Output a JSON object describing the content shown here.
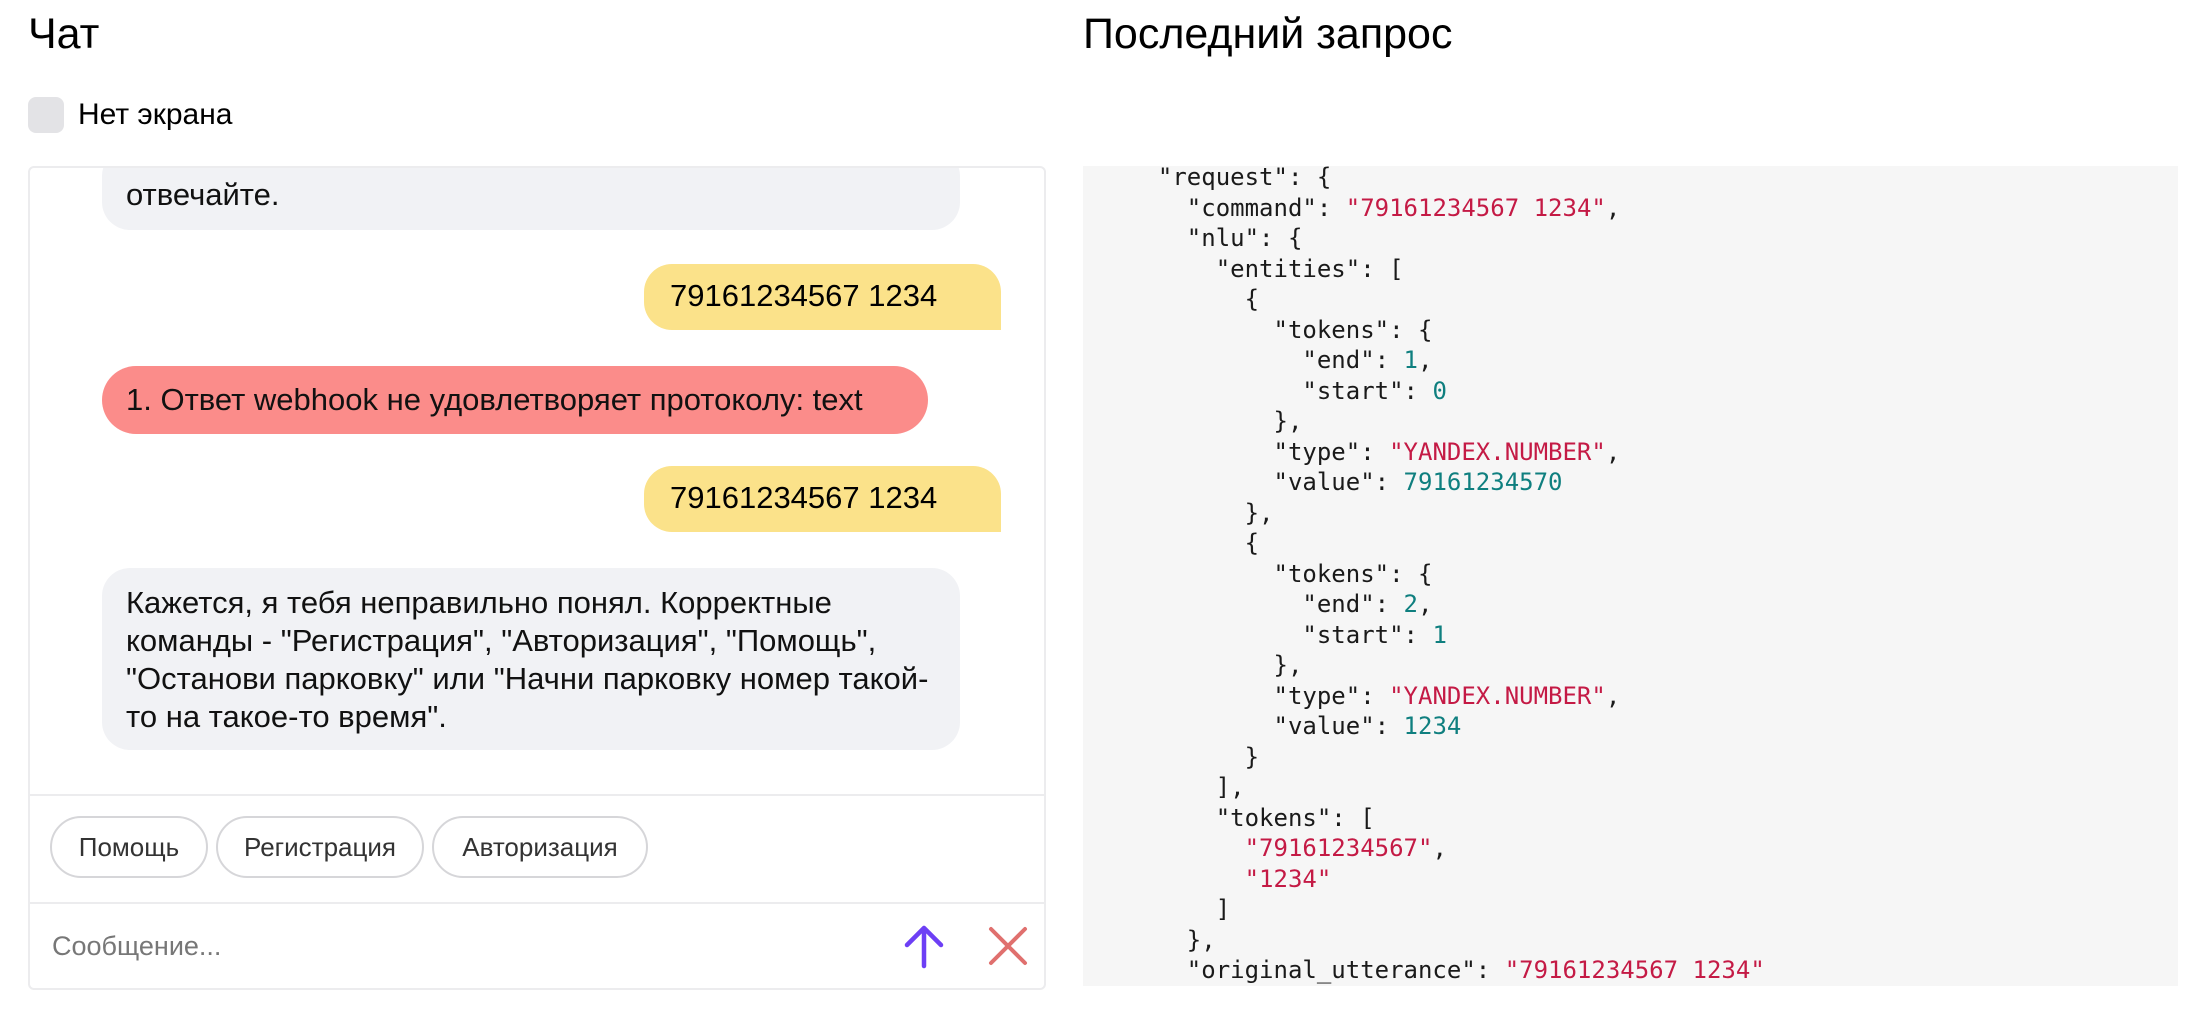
{
  "chat": {
    "title": "Чат",
    "no_screen_label": "Нет экрана",
    "messages": [
      {
        "role": "bot",
        "text": "отвечайте."
      },
      {
        "role": "user",
        "text": "79161234567 1234"
      },
      {
        "role": "error",
        "text": "1. Ответ webhook не удовлетворяет протоколу: text"
      },
      {
        "role": "user",
        "text": "79161234567 1234"
      },
      {
        "role": "bot",
        "text": "Кажется, я тебя неправильно понял. Корректные команды - \"Регистрация\", \"Авторизация\", \"Помощь\", \"Останови парковку\" или \"Начни парковку номер такой-то на такое-то время\"."
      }
    ],
    "suggests": [
      "Помощь",
      "Регистрация",
      "Авторизация"
    ],
    "input_placeholder": "Сообщение...",
    "send_icon": "arrow-up-icon",
    "clear_icon": "close-icon",
    "colors": {
      "user_bubble": "#fbe28a",
      "bot_bubble": "#f1f2f5",
      "error_bubble": "#fb8c8a",
      "send": "#6d3ff5",
      "clear": "#e0706e"
    }
  },
  "request_panel": {
    "title": "Последний запрос",
    "json": {
      "request": {
        "command": "79161234567 1234",
        "nlu": {
          "entities": [
            {
              "tokens": {
                "end": 1,
                "start": 0
              },
              "type": "YANDEX.NUMBER",
              "value": 79161234570
            },
            {
              "tokens": {
                "end": 2,
                "start": 1
              },
              "type": "YANDEX.NUMBER",
              "value": 1234
            }
          ],
          "tokens": [
            "79161234567",
            "1234"
          ]
        },
        "original_utterance": "79161234567 1234"
      }
    }
  }
}
